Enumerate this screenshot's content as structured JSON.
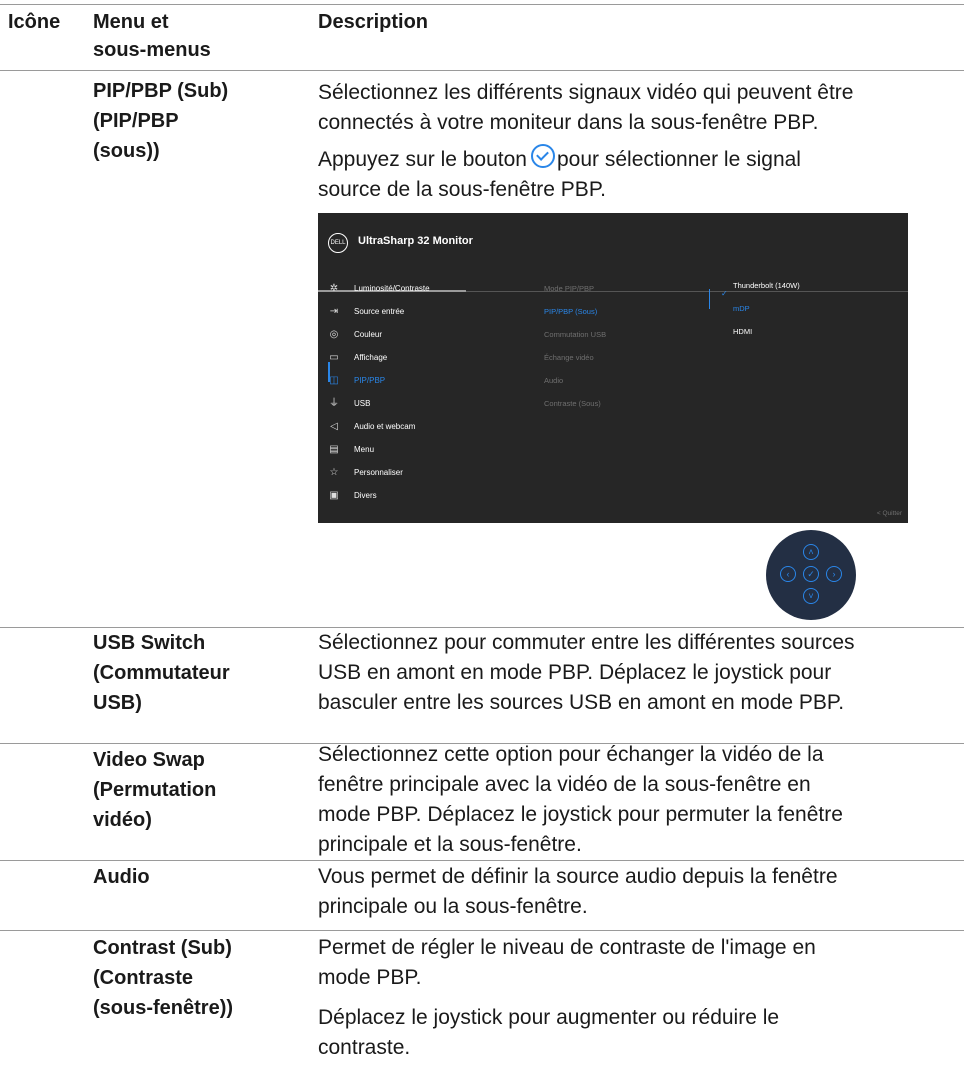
{
  "header": {
    "col_icon": "Icône",
    "col_menu_line1": "Menu et",
    "col_menu_line2": "sous-menus",
    "col_desc": "Description"
  },
  "rows": [
    {
      "menu": [
        "PIP/PBP (Sub)",
        "(PIP/PBP",
        "(sous))"
      ],
      "desc1": [
        "Sélectionnez les différents signaux vidéo qui peuvent être",
        "connectés à votre moniteur dans la sous-fenêtre PBP."
      ],
      "desc2_before": "Appuyez sur le bouton",
      "desc2_after": "pour sélectionner le signal",
      "desc2_line2": "source de la sous-fenêtre PBP."
    },
    {
      "menu": [
        "USB Switch",
        "(Commutateur",
        "USB)"
      ],
      "desc": [
        "Sélectionnez pour commuter entre les différentes sources",
        "USB en amont en mode PBP. Déplacez le joystick pour",
        "basculer entre les sources USB en amont en mode PBP."
      ]
    },
    {
      "menu": [
        "Video Swap",
        "(Permutation",
        "vidéo)"
      ],
      "desc": [
        "Sélectionnez cette option pour échanger la vidéo de la",
        "fenêtre principale avec la vidéo de la sous-fenêtre en",
        "mode PBP. Déplacez le joystick pour permuter la fenêtre",
        "principale et la sous-fenêtre."
      ]
    },
    {
      "menu": [
        "Audio"
      ],
      "desc": [
        "Vous permet de définir la source audio depuis la fenêtre",
        "principale ou la sous-fenêtre."
      ]
    },
    {
      "menu": [
        "Contrast (Sub)",
        "(Contraste",
        "(sous-fenêtre))"
      ],
      "desc1": [
        "Permet de régler le niveau de contraste de l'image en",
        "mode PBP."
      ],
      "desc2": [
        "Déplacez le joystick pour augmenter ou réduire le",
        "contraste."
      ]
    }
  ],
  "osd": {
    "logo": "DELL",
    "title": "UltraSharp 32 Monitor",
    "menu_items": [
      {
        "label": "Luminosité/Contraste",
        "icon": "sun-icon"
      },
      {
        "label": "Source entrée",
        "icon": "input-source-icon"
      },
      {
        "label": "Couleur",
        "icon": "palette-icon"
      },
      {
        "label": "Affichage",
        "icon": "display-icon"
      },
      {
        "label": "PIP/PBP",
        "icon": "pip-icon"
      },
      {
        "label": "USB",
        "icon": "usb-icon"
      },
      {
        "label": "Audio et webcam",
        "icon": "speaker-icon"
      },
      {
        "label": "Menu",
        "icon": "menu-icon"
      },
      {
        "label": "Personnaliser",
        "icon": "star-icon"
      },
      {
        "label": "Divers",
        "icon": "info-icon"
      }
    ],
    "submenu_items": [
      "Mode PIP/PBP",
      "PIP/PBP (Sous)",
      "Commutation USB",
      "Échange vidéo",
      "Audio",
      "Contraste (Sous)"
    ],
    "options": [
      "Thunderbolt (140W)",
      "mDP",
      "HDMI"
    ],
    "exit_label": "< Quitter",
    "active_color": "#2a86e8"
  },
  "joystick": {
    "icons": [
      "up-icon",
      "left-icon",
      "check-icon",
      "right-icon",
      "down-icon"
    ]
  }
}
